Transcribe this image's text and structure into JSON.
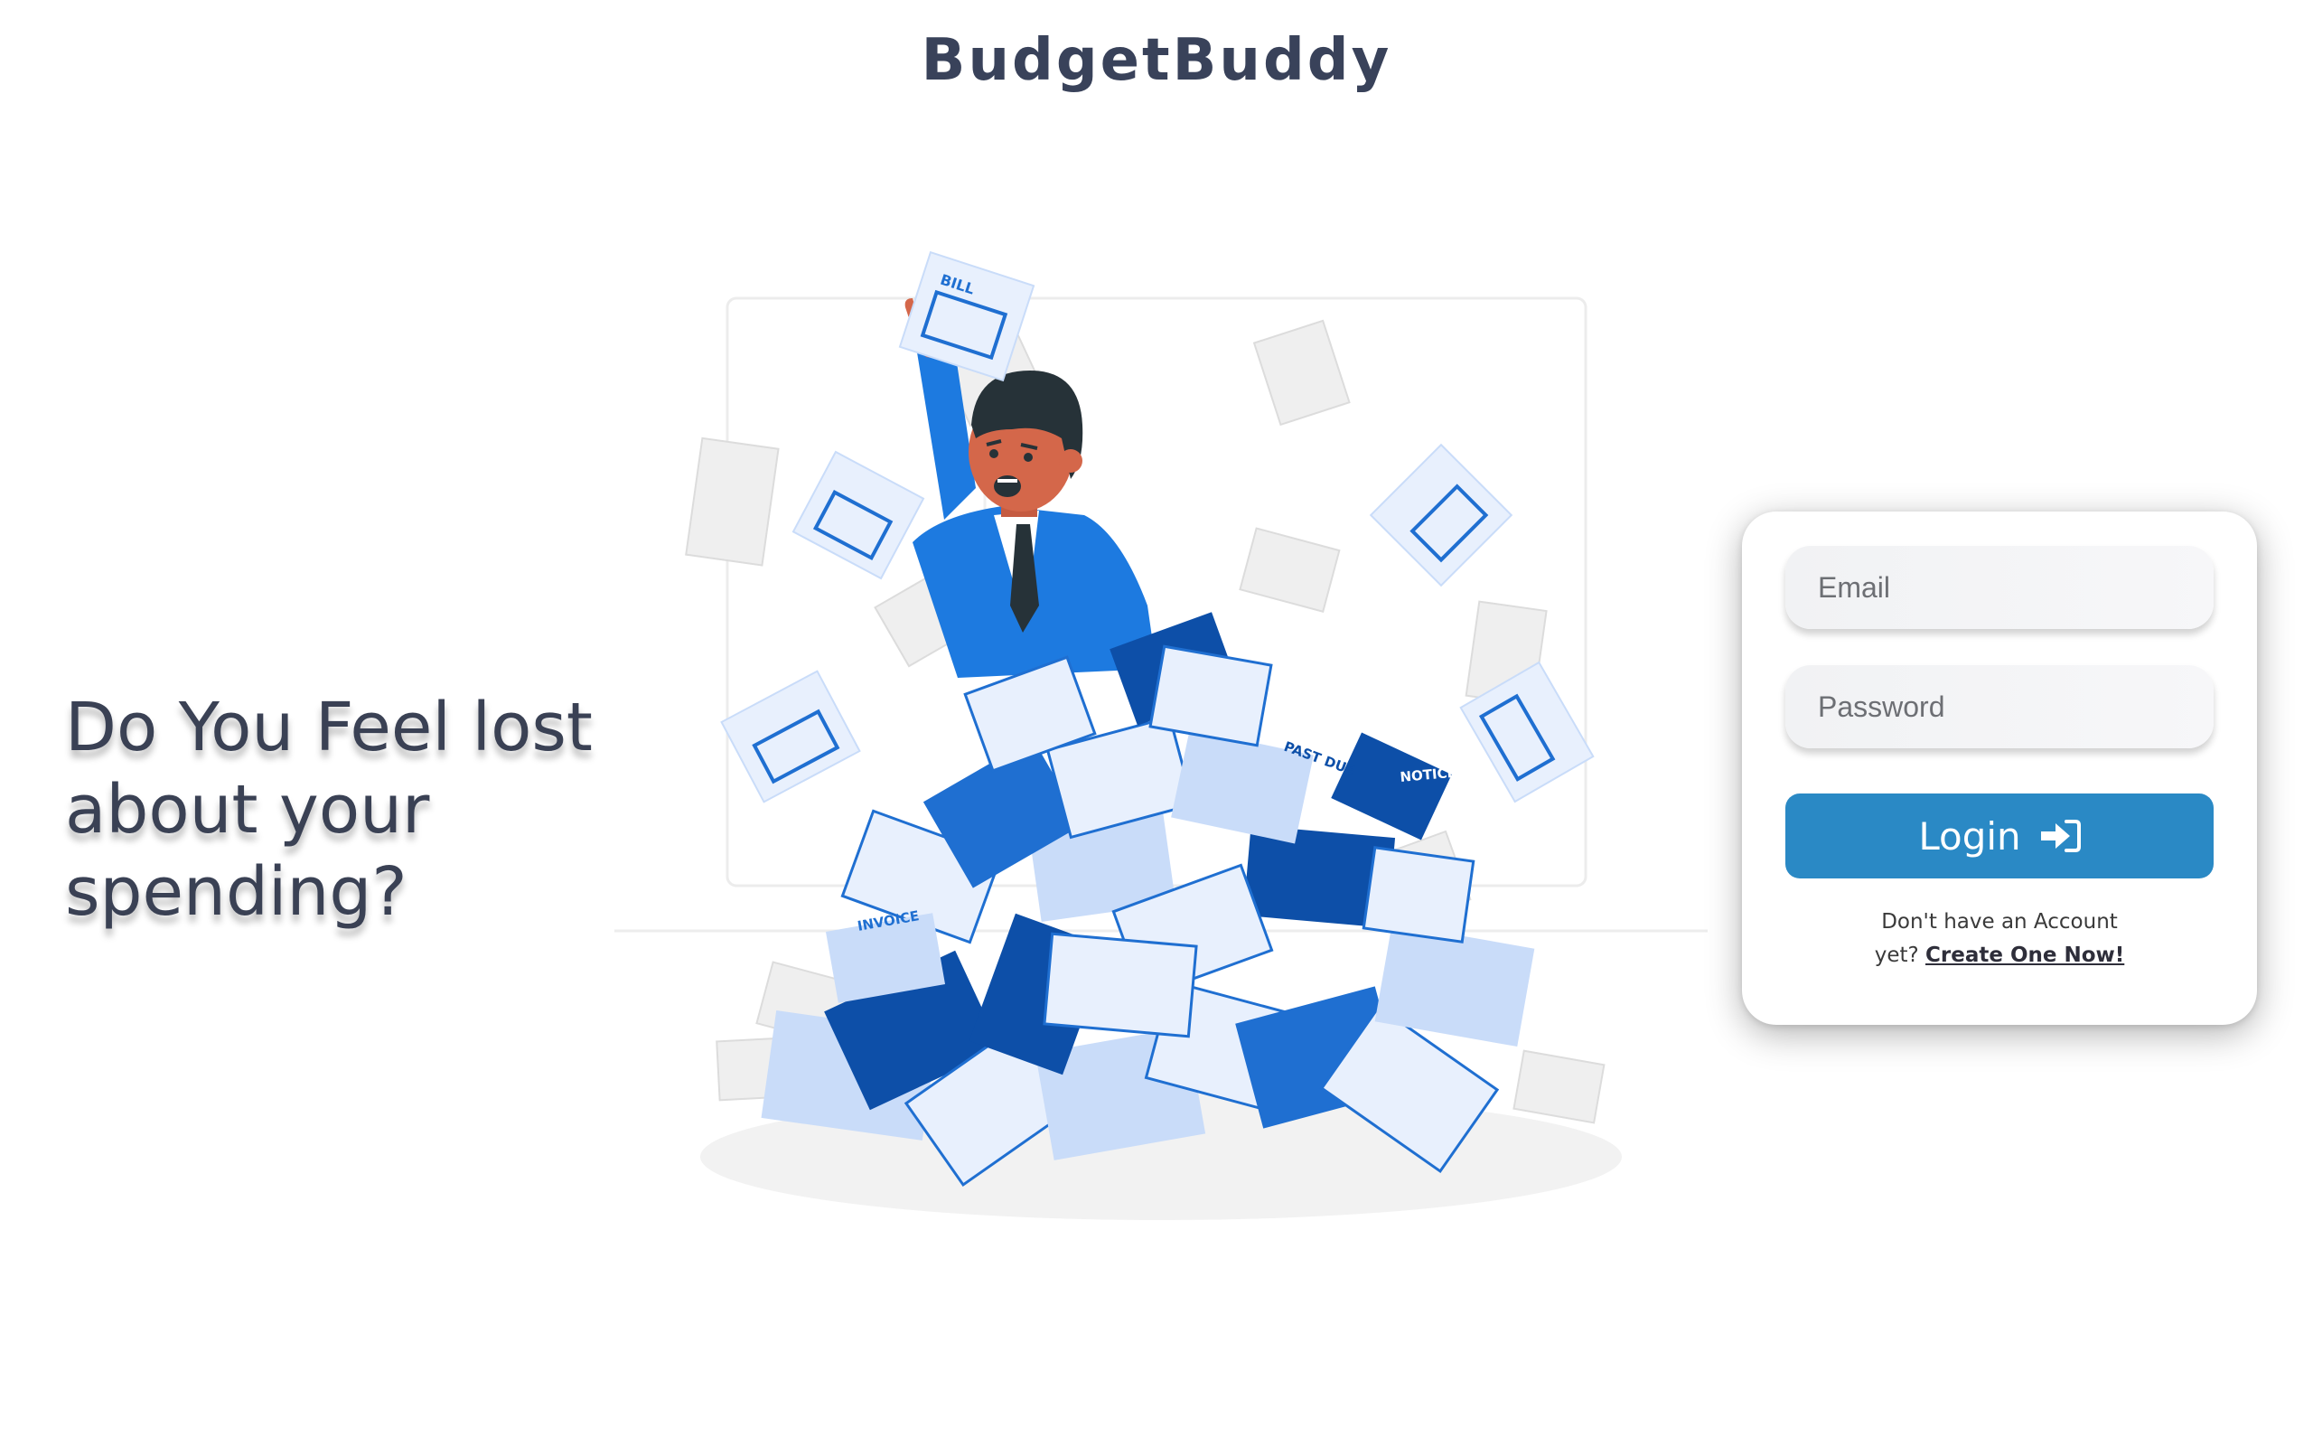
{
  "header": {
    "brand": "BudgetBuddy"
  },
  "hero": {
    "headline_line1": "Do You Feel lost",
    "headline_line2": "about your",
    "headline_line3": "spending?"
  },
  "login_form": {
    "email_placeholder": "Email",
    "password_placeholder": "Password",
    "login_label": "Login",
    "signup_prompt_line1": "Don't have an Account",
    "signup_prompt_line2": "yet?",
    "signup_link": "Create One Now!"
  },
  "illustration": {
    "paper_labels": [
      "BILL",
      "INVOICE",
      "PAST DUE",
      "NOTICE"
    ]
  },
  "colors": {
    "accent": "#2a89c5",
    "text_dark": "#39425a",
    "paper_blue": "#1f6fd1",
    "paper_dark": "#0d4fa8",
    "paper_light": "#c9dcf9"
  }
}
